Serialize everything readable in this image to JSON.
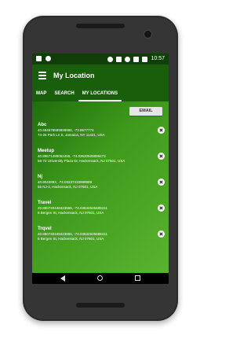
{
  "status_bar": {
    "time": "10:57",
    "left_icons": [
      "screenshot-icon",
      "notification-icon"
    ],
    "right_icons": [
      "location-icon",
      "vibrate-icon",
      "wifi-icon",
      "signal-icon",
      "battery-icon"
    ]
  },
  "app_bar": {
    "title": "My Location",
    "menu_icon": "hamburger-menu-icon"
  },
  "tabs": [
    {
      "label": "MAP",
      "active": false
    },
    {
      "label": "SEARCH",
      "active": false
    },
    {
      "label": "MY LOCATIONS",
      "active": true
    }
  ],
  "email_button": {
    "label": "EMAIL"
  },
  "locations": [
    {
      "name": "Abc",
      "coords": "40.694678599999996, -73.8677774",
      "address": "74-26 Park Ln S, Jamaica, NY 11421, USA"
    },
    {
      "name": "Meetup",
      "coords": "40.89571489062455, -74.03620509899473",
      "address": "56-72 University Plaza Dr, Hackensack, NJ 07601, USA"
    },
    {
      "name": "Nj",
      "coords": "40.9043993, -74.03237419999999",
      "address": "55 NJ-4, Hackensack, NJ 07601, USA"
    },
    {
      "name": "Travel",
      "coords": "40.880740448423865, -74.04532525688411",
      "address": "6 Bergen St, Hackensack, NJ 07601, USA"
    },
    {
      "name": "Trqvel",
      "coords": "40.880740448423865, -74.04532525688411",
      "address": "6 Bergen St, Hackensack, NJ 07601, USA"
    }
  ],
  "nav_bar": {
    "icons": [
      "back-icon",
      "home-icon",
      "recent-apps-icon"
    ]
  },
  "colors": {
    "status_bar": "#0f3f06",
    "app_bar": "#185e0b",
    "content_gradient_start": "#1f6e0d",
    "content_gradient_end": "#5ab330",
    "phone_body": "#2b2b2b"
  }
}
